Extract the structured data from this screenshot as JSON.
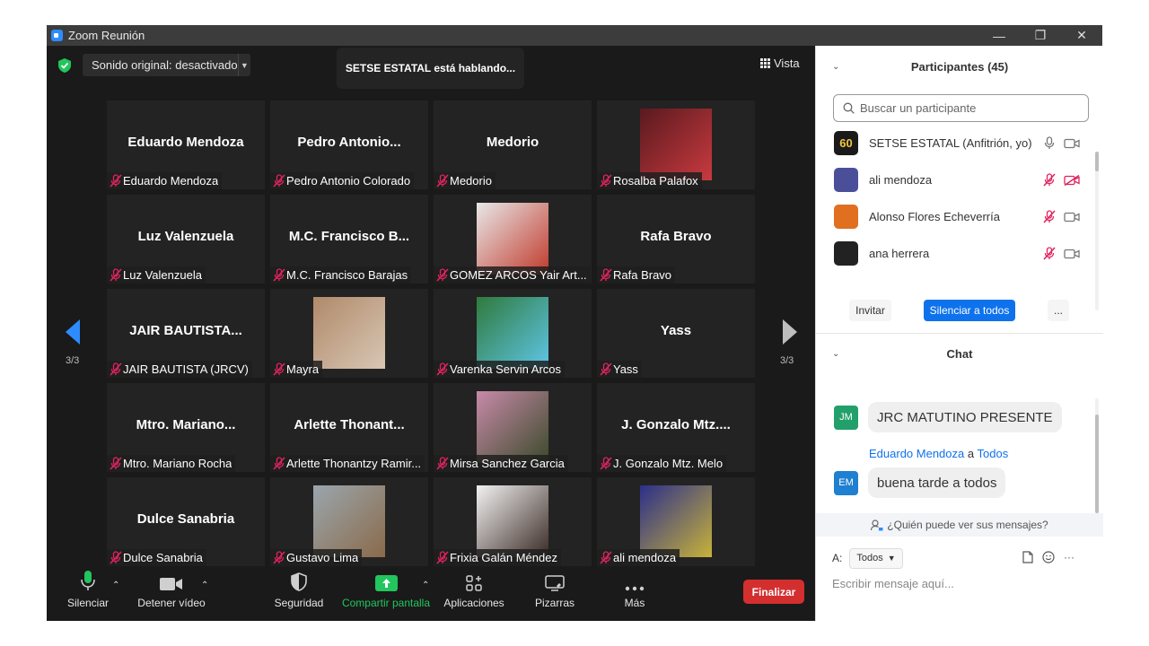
{
  "window": {
    "title": "Zoom Reunión"
  },
  "meeting": {
    "audio_label": "Sonido original: desactivado",
    "speaking": "SETSE ESTATAL está hablando...",
    "view_label": "Vista",
    "page_left": "3/3",
    "page_right": "3/3",
    "tiles": [
      {
        "big": "Eduardo Mendoza",
        "name": "Eduardo Mendoza",
        "photo": false
      },
      {
        "big": "Pedro  Antonio...",
        "name": "Pedro Antonio Colorado",
        "photo": false
      },
      {
        "big": "Medorio",
        "name": "Medorio",
        "photo": false
      },
      {
        "big": "",
        "name": "Rosalba Palafox",
        "photo": true,
        "photo_colors": [
          "#5a1a1f",
          "#c93a3f"
        ]
      },
      {
        "big": "Luz Valenzuela",
        "name": "Luz Valenzuela",
        "photo": false
      },
      {
        "big": "M.C.  Francisco  B...",
        "name": "M.C. Francisco Barajas",
        "photo": false
      },
      {
        "big": "",
        "name": "GOMEZ ARCOS Yair Art...",
        "photo": true,
        "photo_colors": [
          "#e8e8e8",
          "#c0392b"
        ]
      },
      {
        "big": "Rafa Bravo",
        "name": "Rafa Bravo",
        "photo": false
      },
      {
        "big": "JAIR BAUTISTA...",
        "name": "JAIR BAUTISTA (JRCV)",
        "photo": false
      },
      {
        "big": "",
        "name": "Mayra",
        "photo": true,
        "photo_colors": [
          "#b08a6a",
          "#d8c6b4"
        ]
      },
      {
        "big": "",
        "name": "Varenka Servin Arcos",
        "photo": true,
        "photo_colors": [
          "#2f7a3c",
          "#5fc6e8"
        ]
      },
      {
        "big": "Yass",
        "name": "Yass",
        "photo": false
      },
      {
        "big": "Mtro.  Mariano...",
        "name": "Mtro. Mariano Rocha",
        "photo": false
      },
      {
        "big": "Arlette  Thonant...",
        "name": "Arlette Thonantzy Ramir...",
        "photo": false
      },
      {
        "big": "",
        "name": "Mirsa Sanchez Garcia",
        "photo": true,
        "photo_colors": [
          "#c78aa8",
          "#3b4a2b"
        ]
      },
      {
        "big": "J.  Gonzalo  Mtz....",
        "name": "J. Gonzalo Mtz. Melo",
        "photo": false
      },
      {
        "big": "Dulce Sanabria",
        "name": "Dulce Sanabria",
        "photo": false
      },
      {
        "big": "",
        "name": "Gustavo Lima",
        "photo": true,
        "photo_colors": [
          "#9aa6ad",
          "#8a6a4a"
        ]
      },
      {
        "big": "",
        "name": "Frixia Galán Méndez",
        "photo": true,
        "photo_colors": [
          "#f2f2f2",
          "#3a2a24"
        ]
      },
      {
        "big": "",
        "name": "ali mendoza",
        "photo": true,
        "photo_colors": [
          "#2b2f8a",
          "#c8b23a"
        ]
      }
    ]
  },
  "toolbar": {
    "mute": "Silenciar",
    "video": "Detener vídeo",
    "security": "Seguridad",
    "share": "Compartir pantalla",
    "apps": "Aplicaciones",
    "whiteboards": "Pizarras",
    "more": "Más",
    "end": "Finalizar"
  },
  "participants": {
    "title": "Participantes (45)",
    "search_placeholder": "Buscar un participante",
    "list": [
      {
        "name": "SETSE ESTATAL (Anfitrión, yo)",
        "avatar_text": "60",
        "avatar_color": "#1a1a1a",
        "mic_muted": false,
        "video_off": false
      },
      {
        "name": "ali mendoza",
        "avatar_text": "",
        "avatar_color": "#4b4f9a",
        "mic_muted": true,
        "video_off": true
      },
      {
        "name": "Alonso Flores Echeverría",
        "avatar_text": "",
        "avatar_color": "#e07020",
        "mic_muted": true,
        "video_off": false
      },
      {
        "name": "ana herrera",
        "avatar_text": "",
        "avatar_color": "#222222",
        "mic_muted": true,
        "video_off": false
      }
    ],
    "invite": "Invitar",
    "mute_all": "Silenciar a todos",
    "more": "..."
  },
  "chat": {
    "title": "Chat",
    "messages": [
      {
        "initials": "JM",
        "avatar_color": "#22a06b",
        "text": "JRC MATUTINO PRESENTE"
      },
      {
        "initials": "EM",
        "avatar_color": "#1f7fd1",
        "text": "buena tarde a todos"
      }
    ],
    "sender": "Eduardo Mendoza",
    "sender_join": "a",
    "recipient": "Todos",
    "who_can_see": "¿Quién puede ver sus mensajes?",
    "to_label": "A:",
    "to_value": "Todos",
    "input_placeholder": "Escribir mensaje aquí...",
    "more": "···"
  },
  "colors": {
    "accent": "#0e72ed",
    "end": "#d32f2f",
    "share": "#22c55e"
  }
}
